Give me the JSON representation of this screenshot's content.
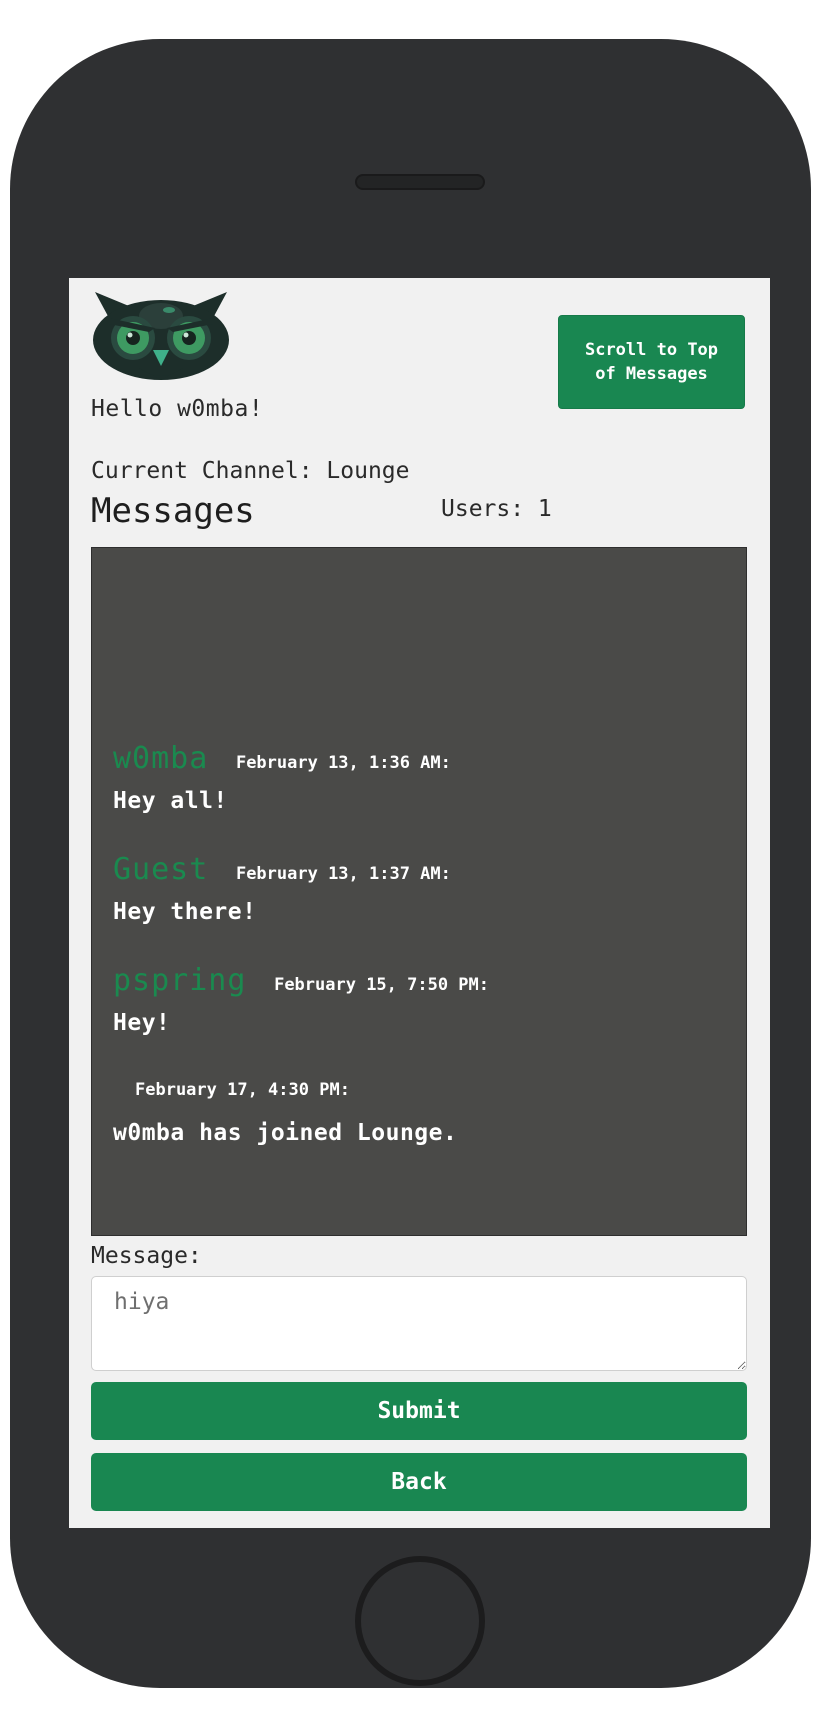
{
  "header": {
    "greeting": "Hello w0mba!",
    "scroll_top_label": "Scroll to Top of Messages"
  },
  "channel": {
    "current": "Current Channel: Lounge",
    "heading": "Messages",
    "users": "Users: 1"
  },
  "messages": [
    {
      "user": "w0mba",
      "time": "February 13, 1:36 AM:",
      "text": "Hey all!"
    },
    {
      "user": "Guest",
      "time": "February 13, 1:37 AM:",
      "text": "Hey there!"
    },
    {
      "user": "pspring",
      "time": "February 15, 7:50 PM:",
      "text": "Hey!"
    },
    {
      "user": "",
      "time": "February 17, 4:30 PM:",
      "text": "w0mba has joined Lounge."
    }
  ],
  "form": {
    "message_label": "Message:",
    "message_value": "hiya",
    "submit_label": "Submit",
    "back_label": "Back"
  },
  "colors": {
    "accent": "#198751",
    "username": "#1a8a4f",
    "message_box_bg": "#4a4a48",
    "phone_body": "#2f3032",
    "screen_bg": "#f1f1f1"
  },
  "icons": {
    "logo": "owl-logo-icon"
  }
}
